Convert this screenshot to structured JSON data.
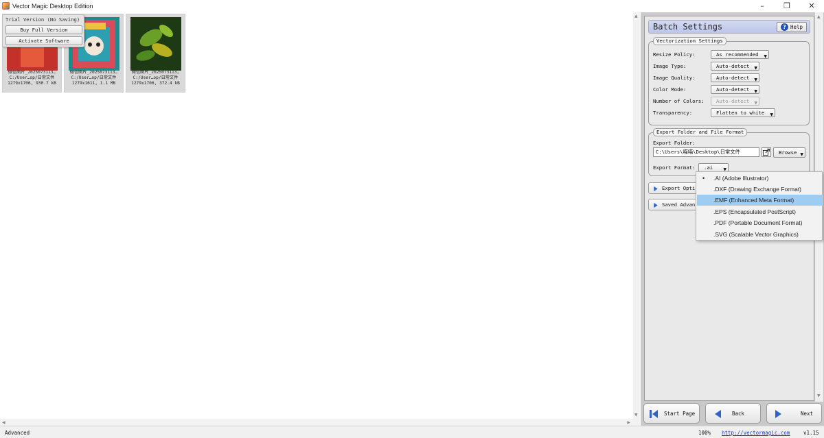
{
  "window": {
    "title": "Vector Magic Desktop Edition",
    "minimize": "–",
    "maximize": "❐",
    "close": "✕"
  },
  "trial": {
    "notice": "Trial Version (No Saving)",
    "buy_label": "Buy Full Version",
    "activate_label": "Activate Software"
  },
  "thumbnails": [
    {
      "name": "微信图片_2025073113…",
      "path": "C:/User…op/日常文件",
      "info": "1279x1706, 930.7 kB"
    },
    {
      "name": "微信图片_2025073113…",
      "path": "C:/User…op/日常文件",
      "info": "1279x1611, 1.1 MB"
    },
    {
      "name": "微信图片_2025073113…",
      "path": "C:/User…op/日常文件",
      "info": "1279x1706, 372.4 kB"
    }
  ],
  "panel": {
    "title": "Batch Settings",
    "help_label": "Help",
    "vectorization": {
      "title": "Vectorization Settings",
      "rows": [
        {
          "label": "Resize Policy:",
          "value": "As recommended"
        },
        {
          "label": "Image Type:",
          "value": "Auto-detect"
        },
        {
          "label": "Image Quality:",
          "value": "Auto-detect"
        },
        {
          "label": "Color Mode:",
          "value": "Auto-detect"
        },
        {
          "label": "Number of Colors:",
          "value": "Auto-detect"
        },
        {
          "label": "Transparency:",
          "value": "Flatten to white"
        }
      ]
    },
    "export": {
      "title": "Export Folder and File Format",
      "folder_label": "Export Folder:",
      "folder_value": "C:\\Users\\喵喵\\Desktop\\日常文件",
      "browse_label": "Browse",
      "format_label": "Export Format:",
      "format_value": ".ai"
    },
    "export_options_label": "Export Opti",
    "saved_advanced_label": "Saved Advan"
  },
  "format_menu": {
    "items": [
      {
        "label": ".AI (Adobe Illustrator)",
        "selected": true
      },
      {
        "label": ".DXF (Drawing Exchange Format)"
      },
      {
        "label": ".EMF (Enhanced Meta Format)",
        "highlighted": true
      },
      {
        "label": ".EPS (Encapsulated PostScript)"
      },
      {
        "label": ".PDF (Portable Document Format)"
      },
      {
        "label": ".SVG (Scalable Vector Graphics)"
      }
    ],
    "selected_mark": "•"
  },
  "nav": {
    "start_label": "Start Page",
    "back_label": "Back",
    "next_label": "Next"
  },
  "status": {
    "mode": "Advanced",
    "zoom": "100%",
    "link": "http://vectormagic.com",
    "version": "v1.15"
  },
  "colors": {
    "accent_blue": "#2e64c4",
    "menu_highlight": "#9fcdf2",
    "header_tint": "#c6cfee"
  }
}
